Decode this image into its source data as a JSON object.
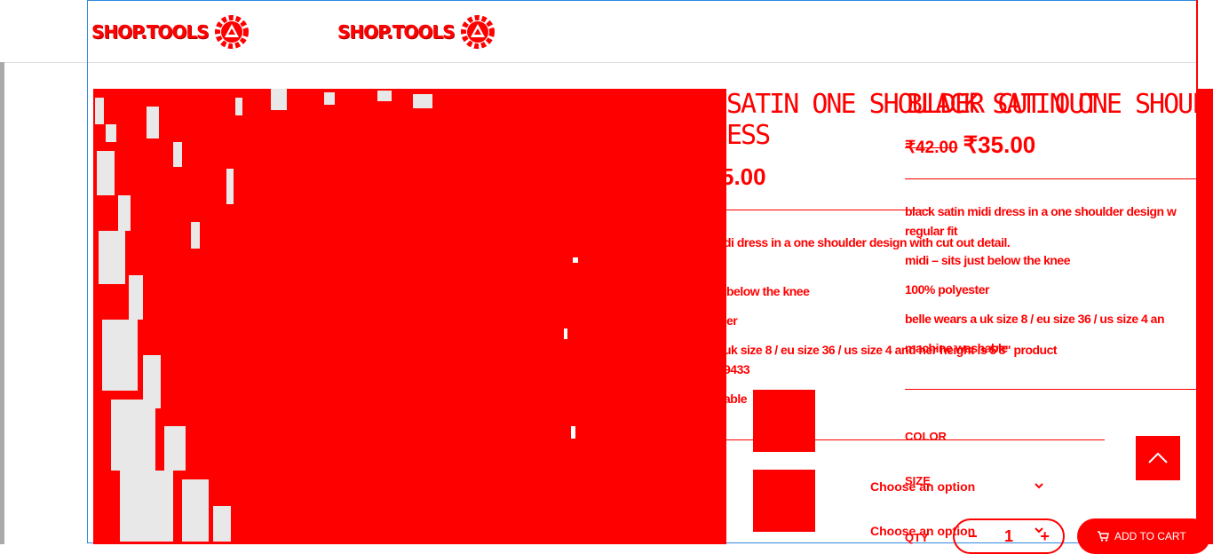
{
  "header": {
    "logo_text_1": "SHOP.TOOLS",
    "logo_text_2": "SHOP.TOOLS"
  },
  "product_a": {
    "title_line1": "SATIN ONE SHOULDER CUT OUT",
    "title_line2": "ESS",
    "price_partial": "5.00",
    "desc_1": "di dress in a one shoulder design with cut out detail.",
    "desc_2": "below the knee",
    "desc_3": "er",
    "desc_4": "uk size 8 / eu size 36 / us size 4 and her height is 5'8\" product",
    "desc_5": "9433",
    "desc_6": "able"
  },
  "product_b": {
    "title": "BLACK SATIN ONE SHOULDER",
    "old_price": "₹42.00",
    "price": "₹35.00",
    "desc_1": "black satin midi dress in a one shoulder design w",
    "desc_2": "regular fit",
    "desc_3": "midi – sits just below the knee",
    "desc_4": "100% polyester",
    "desc_5": "belle wears a uk size 8 / eu size 36 / us size 4 an",
    "desc_6": "machine washable",
    "color_label": "COLOR",
    "size_label": "SIZE",
    "qty_label": "QTY",
    "color_select": "Choose an option",
    "size_select": "Choose an option",
    "qty_value": "1",
    "qty_minus": "−",
    "qty_plus": "+",
    "add_to_cart": "ADD TO CART"
  },
  "colors": {
    "accent": "#ff0000",
    "frame_border": "#2f89e0"
  },
  "icons": {
    "logo": "gear-logo-icon",
    "chevron": "chevron-down-icon",
    "cart": "cart-icon",
    "scroll_top": "chevron-up-icon"
  }
}
